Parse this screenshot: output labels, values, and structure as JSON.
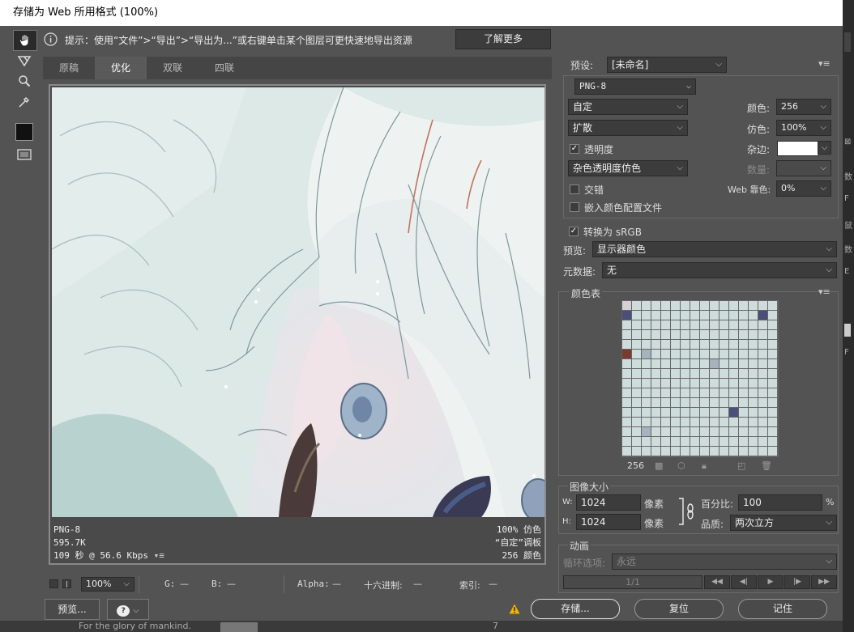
{
  "window": {
    "title": "存储为 Web 所用格式 (100%)"
  },
  "infobar": {
    "hint": "提示：使用“文件”>“导出”>“导出为...”或右键单击某个图层可更快速地导出资源",
    "learn_more": "了解更多"
  },
  "tabs": [
    "原稿",
    "优化",
    "双联",
    "四联"
  ],
  "image_info": {
    "format": "PNG-8",
    "size": "595.7K",
    "time": "109 秒 @ 56.6 Kbps",
    "dither": "100% 仿色",
    "palette": "“自定”调板",
    "colors": "256 颜色"
  },
  "statusbar": {
    "zoom": "100%",
    "g_label": "G:",
    "g_value": "—",
    "b_label": "B:",
    "b_value": "—",
    "alpha_label": "Alpha:",
    "alpha_value": "—",
    "hex_label": "十六进制:",
    "hex_value": "—",
    "index_label": "索引:",
    "index_value": "—"
  },
  "bottom": {
    "preview_button": "预览...",
    "save_button": "存储...",
    "reset_button": "复位",
    "remember_button": "记住",
    "behind_text": "For the glory of mankind.",
    "behind_number": "7"
  },
  "settings": {
    "preset_label": "预设:",
    "preset_value": "[未命名]",
    "format": "PNG-8",
    "reduction": "自定",
    "dither_algorithm": "扩散",
    "transparency_label": "透明度",
    "transparency_checked": true,
    "transparency_dither": "杂色透明度仿色",
    "interlaced_label": "交错",
    "interlaced_checked": false,
    "embed_profile_label": "嵌入颜色配置文件",
    "embed_profile_checked": false,
    "colors_label": "颜色:",
    "colors_value": "256",
    "dither_label": "仿色:",
    "dither_value": "100%",
    "matte_label": "杂边:",
    "matte_color": "#ffffff",
    "amount_label": "数量:",
    "web_snap_label": "Web 靠色:",
    "web_snap_value": "0%",
    "convert_srgb_label": "转换为 sRGB",
    "convert_srgb_checked": true,
    "preview_label": "预览:",
    "preview_value": "显示器颜色",
    "metadata_label": "元数据:",
    "metadata_value": "无"
  },
  "color_table": {
    "title": "颜色表",
    "count": "256"
  },
  "image_size": {
    "title": "图像大小",
    "w_label": "W:",
    "w_value": "1024",
    "h_label": "H:",
    "h_value": "1024",
    "unit": "像素",
    "percent_label": "百分比:",
    "percent_value": "100",
    "percent_unit": "%",
    "quality_label": "品质:",
    "quality_value": "两次立方"
  },
  "animation": {
    "title": "动画",
    "loop_label": "循环选项:",
    "loop_value": "永远",
    "frame": "1/1"
  },
  "icons": [
    "hand-icon",
    "slice-select-icon",
    "zoom-icon",
    "eyedropper-icon",
    "eyedropper-color-icon",
    "toggle-slices-icon",
    "info-icon",
    "panel-menu-icon",
    "warning-icon",
    "link-icon"
  ],
  "colors": {
    "accent_warning": "#f5b300",
    "bg": "#535353",
    "field": "#3c3c3c"
  }
}
